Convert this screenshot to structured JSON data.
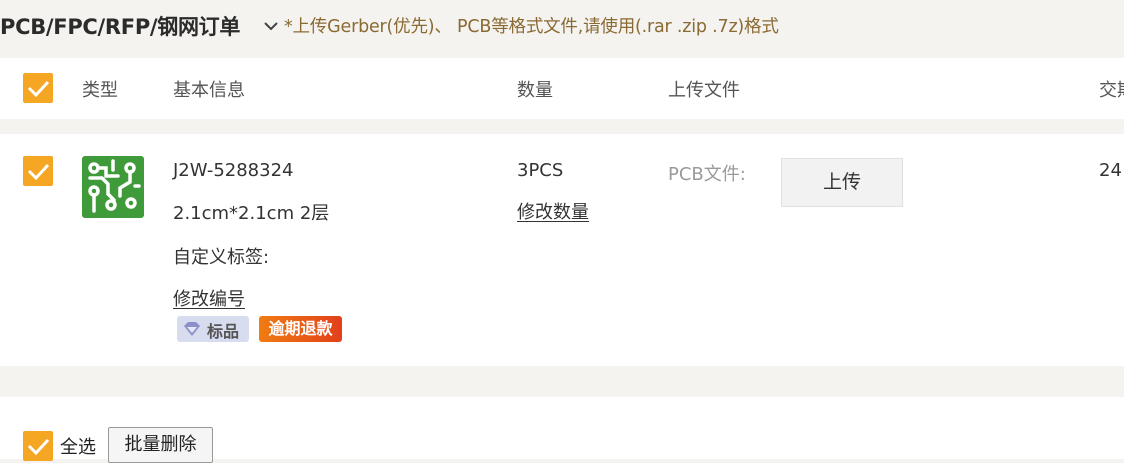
{
  "header": {
    "title": "PCB/FPC/RFP/钢网订单",
    "hint": "*上传Gerber(优先)、 PCB等格式文件,请使用(.rar .zip .7z)格式"
  },
  "columns": {
    "type": "类型",
    "info": "基本信息",
    "qty": "数量",
    "upload": "上传文件",
    "delivery": "交期"
  },
  "order": {
    "id": "J2W-5288324",
    "spec": "2.1cm*2.1cm 2层",
    "custom_label": "自定义标签:",
    "edit_number": "修改编号",
    "qty": "3PCS",
    "edit_qty": "修改数量",
    "file_label": "PCB文件:",
    "upload_label": "上传",
    "delivery": "24",
    "badges": [
      "标品",
      "逾期退款"
    ]
  },
  "footer": {
    "select_all": "全选",
    "bulk_delete": "批量删除"
  },
  "colors": {
    "accent": "#f5a623",
    "pcb_green": "#3f9a3a",
    "refund_badge": "#e9551a",
    "standard_badge": "#d8dcef"
  }
}
